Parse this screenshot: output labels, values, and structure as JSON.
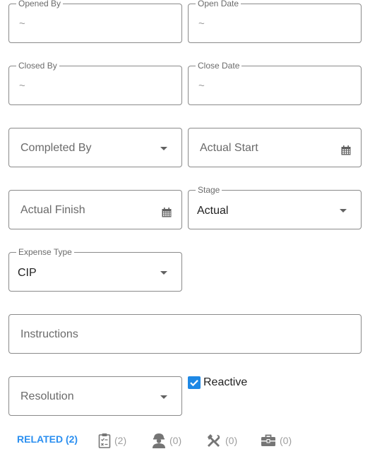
{
  "fields": {
    "opened_by": {
      "label": "Opened By",
      "value": "~"
    },
    "open_date": {
      "label": "Open Date",
      "value": "~"
    },
    "closed_by": {
      "label": "Closed By",
      "value": "~"
    },
    "close_date": {
      "label": "Close Date",
      "value": "~"
    },
    "completed_by": {
      "placeholder": "Completed By"
    },
    "actual_start": {
      "placeholder": "Actual Start"
    },
    "actual_finish": {
      "placeholder": "Actual Finish"
    },
    "stage": {
      "label": "Stage",
      "value": "Actual"
    },
    "expense_type": {
      "label": "Expense Type",
      "value": "CIP"
    },
    "instructions": {
      "placeholder": "Instructions"
    },
    "resolution": {
      "placeholder": "Resolution"
    },
    "reactive": {
      "label": "Reactive",
      "checked": true
    }
  },
  "tabs": {
    "related": "RELATED (2)",
    "checklist_count": "(2)",
    "workers_count": "(0)",
    "tools_count": "(0)",
    "kits_count": "(0)"
  },
  "colors": {
    "accent": "#2b8ff0",
    "checkbox": "#1e88e5",
    "icon": "#757575"
  }
}
